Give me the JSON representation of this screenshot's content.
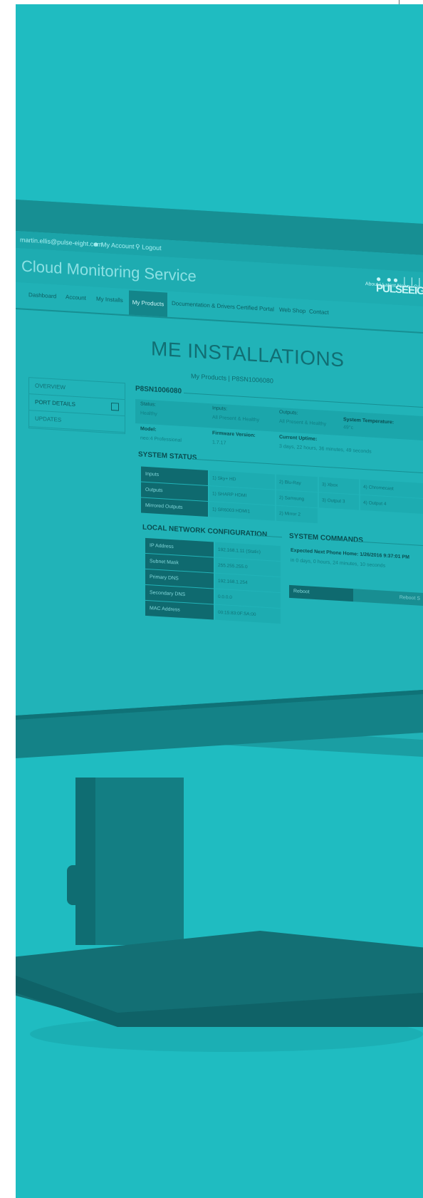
{
  "topbar": {
    "email": "martin.ellis@pulse-eight.com",
    "my_account": "My Account",
    "logout": "Logout"
  },
  "header": {
    "title": "Cloud Monitoring Service",
    "toplinks": "About  |  Latest News  |  Co",
    "logo_dots": "● ●● | | |",
    "logo_word": "PULSEEIGH"
  },
  "nav": {
    "items": [
      "Dashboard",
      "Account",
      "My Installs",
      "My Products",
      "Documentation & Drivers",
      "Certified Portal",
      "Web Shop",
      "Contact"
    ]
  },
  "page": {
    "heading": "ME INSTALLATIONS",
    "breadcrumb_root": "My Products",
    "breadcrumb_sep": "|",
    "breadcrumb_current": "P8SN1006080"
  },
  "sidemenu": {
    "items": [
      "OVERVIEW",
      "PORT DETAILS",
      "UPDATES"
    ]
  },
  "device": {
    "id": "P8SN1006080",
    "status_label": "Status:",
    "status_value": "Healthy",
    "inputs_label": "Inputs:",
    "inputs_value": "All Present & Healthy",
    "outputs_label": "Outputs:",
    "outputs_value": "All Present & Healthy",
    "temp_label": "System Temperature:",
    "temp_value": "49°c",
    "model_label": "Model:",
    "model_value": "neo:4 Professional",
    "firmware_label": "Firmware Version:",
    "firmware_value": "1.7.17",
    "uptime_label": "Current Uptime:",
    "uptime_value": "3 days, 22 hours, 36 minutes, 49 seconds"
  },
  "system_status": {
    "title": "SYSTEM STATUS",
    "rows": [
      {
        "head": "Inputs",
        "cells": [
          "1) Sky+ HD",
          "2) Blu-Ray",
          "3) Xbox",
          "4) Chromecast"
        ]
      },
      {
        "head": "Outputs",
        "cells": [
          "1) SHARP HDMI",
          "2) Samsung",
          "3) Output 3",
          "4) Output 4"
        ]
      },
      {
        "head": "Mirrored Outputs",
        "cells": [
          "1) SR6003 HDMI1",
          "2) Mirror 2",
          "",
          ""
        ]
      }
    ]
  },
  "network": {
    "title": "LOCAL NETWORK CONFIGURATION",
    "rows": [
      {
        "head": "IP Address",
        "value": "192.168.1.11 (Static)"
      },
      {
        "head": "Subnet Mask",
        "value": "255.255.255.0"
      },
      {
        "head": "Primary DNS",
        "value": "192.168.1.254"
      },
      {
        "head": "Secondary DNS",
        "value": "0.0.0.0"
      },
      {
        "head": "MAC Address",
        "value": "00:15:83:0F:5A:00"
      }
    ]
  },
  "commands": {
    "title": "SYSTEM COMMANDS",
    "next_phone_home": "Expected Next Phone Home: 1/26/2016 9:37:01 PM",
    "countdown": "in 0 days, 0 hours, 24 minutes, 10 seconds",
    "reboot_label": "Reboot",
    "reboot_right": "Reboot S"
  },
  "colors": {
    "background": "#1fbcc1",
    "accent_dark": "#0f6a6f"
  }
}
